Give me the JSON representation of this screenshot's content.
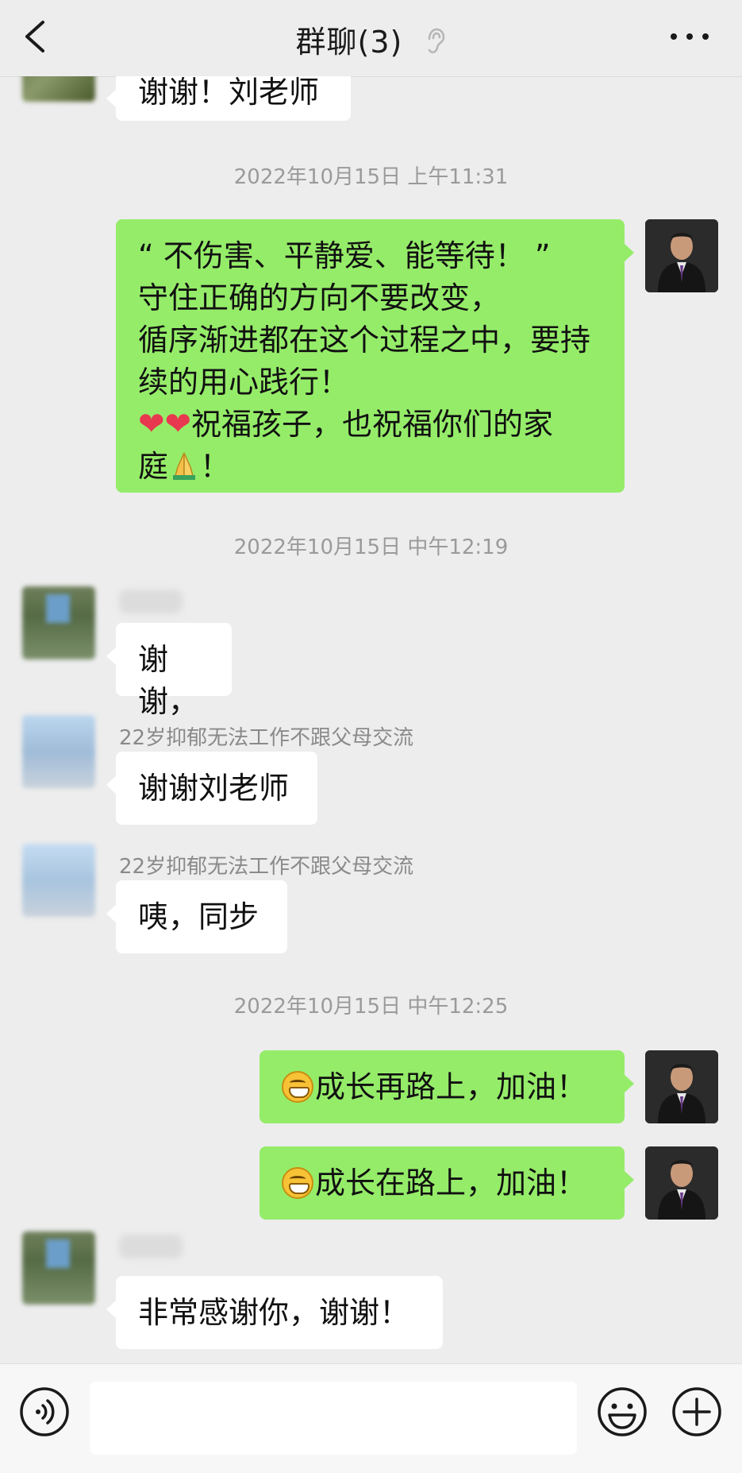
{
  "header": {
    "title": "群聊(3)"
  },
  "messages": [
    {
      "text": "谢谢！刘老师"
    },
    {
      "timestamp": "2022年10月15日 上午11:31"
    },
    {
      "lines": [
        "“ 不伤害、平静爱、能等待！ ”",
        "守住正确的方向不要改变，",
        "循序渐进都在这个过程之中，要持",
        "续的用心践行！",
        "祝福孩子，也祝福你们的家",
        "庭",
        "！"
      ],
      "emoji": [
        "red-heart",
        "red-heart",
        "folded-hands"
      ]
    },
    {
      "timestamp": "2022年10月15日 中午12:19"
    },
    {
      "text": "谢谢，"
    },
    {
      "sender": "22岁抑郁无法工作不跟父母交流",
      "text": "谢谢刘老师"
    },
    {
      "sender": "22岁抑郁无法工作不跟父母交流",
      "text": "咦，同步"
    },
    {
      "timestamp": "2022年10月15日 中午12:25"
    },
    {
      "text": "成长再路上，加油！",
      "emoji": "grinning-face"
    },
    {
      "text": "成长在路上，加油！",
      "emoji": "grinning-face"
    },
    {
      "text": "非常感谢你，谢谢！"
    }
  ],
  "colors": {
    "background": "#ededed",
    "outgoing_bubble": "#95ec69",
    "incoming_bubble": "#ffffff",
    "timestamp_text": "#9a9a9a"
  },
  "icons": {
    "back": "chevron-left-icon",
    "ear": "ear-icon",
    "more": "more-dots-icon",
    "voice": "voice-icon",
    "emoji": "emoji-icon",
    "add": "plus-icon"
  }
}
